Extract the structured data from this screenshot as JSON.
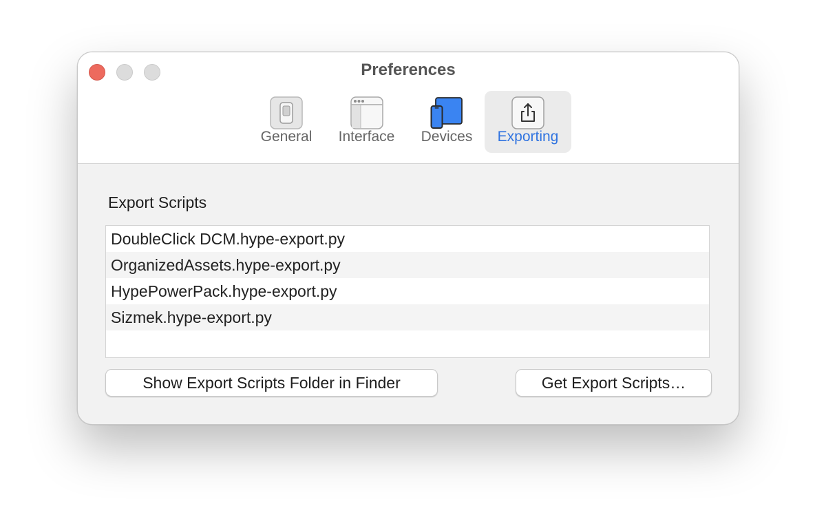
{
  "window": {
    "title": "Preferences"
  },
  "tabs": [
    {
      "label": "General",
      "icon": "toggle-switch-icon"
    },
    {
      "label": "Interface",
      "icon": "window-layout-icon"
    },
    {
      "label": "Devices",
      "icon": "devices-icon"
    },
    {
      "label": "Exporting",
      "icon": "share-export-icon",
      "selected": true
    }
  ],
  "colors": {
    "accent": "#2f73e0",
    "close": "#ed6a5e",
    "inactive_traffic": "#dcdcdc"
  },
  "export": {
    "section_label": "Export Scripts",
    "scripts": [
      "DoubleClick DCM.hype-export.py",
      "OrganizedAssets.hype-export.py",
      "HypePowerPack.hype-export.py",
      "Sizmek.hype-export.py"
    ],
    "show_folder_button": "Show Export Scripts Folder in Finder",
    "get_scripts_button": "Get Export Scripts…"
  }
}
